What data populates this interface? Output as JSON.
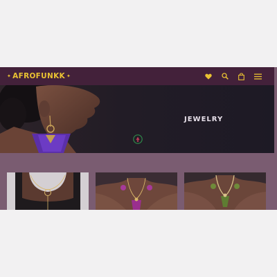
{
  "brand": {
    "star_left": "✦",
    "name": "AFROFUNKK",
    "star_right": "✦"
  },
  "nav_icons": [
    "heart-icon",
    "search-icon",
    "shopping-bag-icon",
    "menu-icon"
  ],
  "hero": {
    "title": "JEWELRY"
  },
  "products": [
    {
      "name": "gold-lariat-necklace"
    },
    {
      "name": "beaded-tassel-necklace"
    },
    {
      "name": "green-stone-necklace"
    }
  ],
  "colors": {
    "nav_bg": "#43213a",
    "accent_gold": "#e9c232",
    "hero_bg": "#1f1a26",
    "band_bg": "#7a5c71",
    "tassel_purple": "#5b2fa8"
  }
}
